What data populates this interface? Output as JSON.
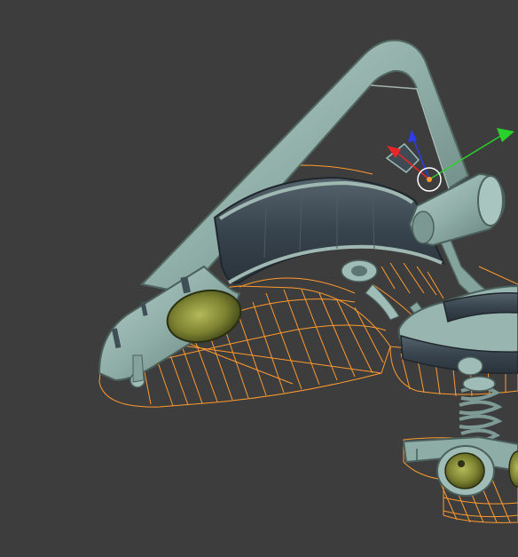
{
  "viewport": {
    "background": "#3d3d3d",
    "mode": "3d-viewport"
  },
  "scene": {
    "object": "lamp-fixture-model",
    "selection_wire_color": "#ff9a2e",
    "model_colors": {
      "metal_light": "#9fbdb6",
      "metal_mid": "#7f9f99",
      "metal_dark": "#4e6665",
      "band_dark": "#3a4751",
      "lens_olive": "#8a8f3a",
      "lens_inner": "#5c6226"
    }
  },
  "gizmo": {
    "x_axis_color": "#e8262a",
    "y_axis_color": "#2ad12a",
    "z_axis_color": "#2c3df0",
    "pivot_color": "#ff9a2e",
    "pivot_ring_color": "#ffffff"
  }
}
